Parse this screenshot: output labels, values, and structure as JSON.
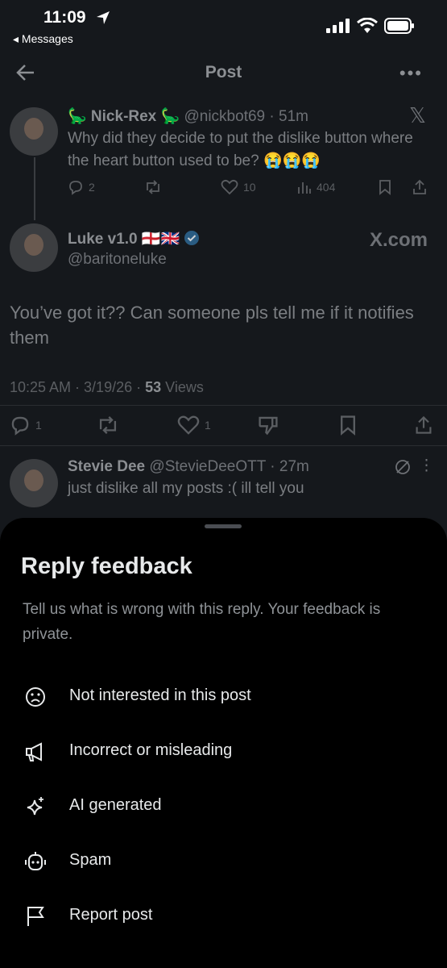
{
  "status_bar": {
    "time": "11:09",
    "back_app": "Messages"
  },
  "header": {
    "title": "Post"
  },
  "parent_post": {
    "display_name": "🦕 Nick-Rex 🦕",
    "handle": "@nickbot69",
    "age": "· 51m",
    "text": "Why did they decide to put the dislike button where the heart button used to be? 😭😭😭",
    "replies": "2",
    "likes": "10",
    "views": "404"
  },
  "main_post": {
    "display_name": "Luke v1.0 🏴󠁧󠁢󠁥󠁮󠁧󠁿🇬🇧",
    "handle": "@baritoneluke",
    "source": "X.com",
    "text": "You’ve got it?? Can someone pls tell me if it notifies them",
    "timestamp": "10:25 AM · 3/19/26 ·",
    "views_count": "53",
    "views_label": "Views",
    "replies": "1",
    "likes": "1"
  },
  "reply_post": {
    "display_name": "Stevie Dee",
    "handle": "@StevieDeeOTT",
    "age": "· 27m",
    "text": "just dislike all my posts :( ill tell you"
  },
  "sheet": {
    "title": "Reply feedback",
    "description": "Tell us what is wrong with this reply. Your feedback is private.",
    "options": [
      {
        "label": "Not interested in this post",
        "icon": "frown-face-icon"
      },
      {
        "label": "Incorrect or misleading",
        "icon": "megaphone-icon"
      },
      {
        "label": "AI generated",
        "icon": "sparkle-icon"
      },
      {
        "label": "Spam",
        "icon": "robot-icon"
      },
      {
        "label": "Report post",
        "icon": "flag-icon"
      }
    ]
  },
  "colors": {
    "sheet_bg": "#000000",
    "page_bg": "#15181c",
    "verified": "#1d9bf0"
  }
}
